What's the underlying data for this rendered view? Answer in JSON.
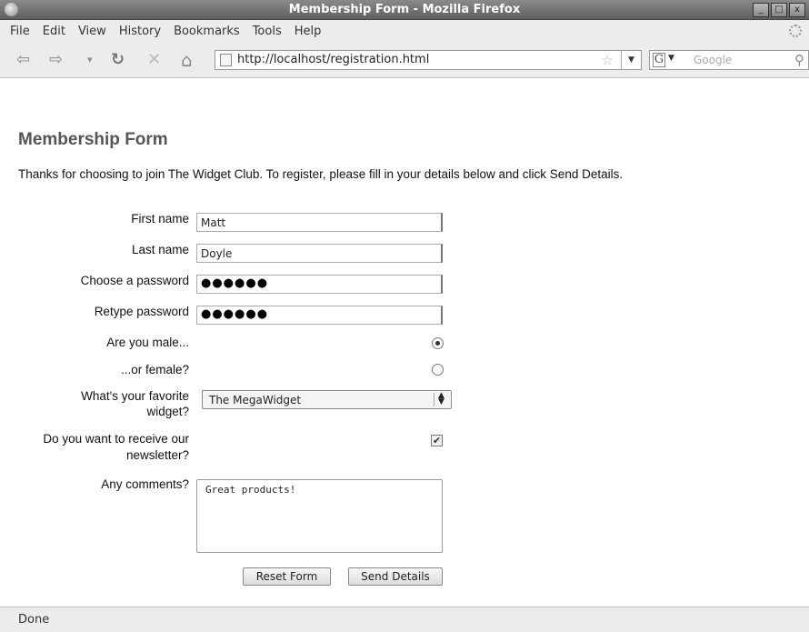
{
  "window": {
    "title": "Membership Form - Mozilla Firefox",
    "buttons": [
      "_",
      "□",
      "x"
    ]
  },
  "menu": [
    "File",
    "Edit",
    "View",
    "History",
    "Bookmarks",
    "Tools",
    "Help"
  ],
  "nav": {
    "back_icon": "⇦",
    "forward_icon": "⇨",
    "history_drop": "▾",
    "reload_icon": "↻",
    "stop_icon": "✕",
    "home_icon": "⌂",
    "url": "http://localhost/registration.html",
    "search_engine": "G",
    "search_placeholder": "Google"
  },
  "page": {
    "title": "Membership Form",
    "intro": "Thanks for choosing to join The Widget Club. To register, please fill in your details below and click Send Details."
  },
  "form": {
    "first_name_label": "First name",
    "first_name_value": "Matt",
    "last_name_label": "Last name",
    "last_name_value": "Doyle",
    "password_label": "Choose a password",
    "password_value": "●●●●●●",
    "retype_label": "Retype password",
    "retype_value": "●●●●●●",
    "male_label": "Are you male...",
    "male_checked": true,
    "female_label": "...or female?",
    "female_checked": false,
    "widget_label_line1": "What's your favorite",
    "widget_label_line2": "widget?",
    "widget_selected": "The MegaWidget",
    "newsletter_label_line1": "Do you want to receive our",
    "newsletter_label_line2": "newsletter?",
    "newsletter_checked": true,
    "check_mark": "✔",
    "comments_label": "Any comments?",
    "comments_value": "Great products!",
    "reset_label": "Reset Form",
    "send_label": "Send Details"
  },
  "status": {
    "text": "Done"
  }
}
